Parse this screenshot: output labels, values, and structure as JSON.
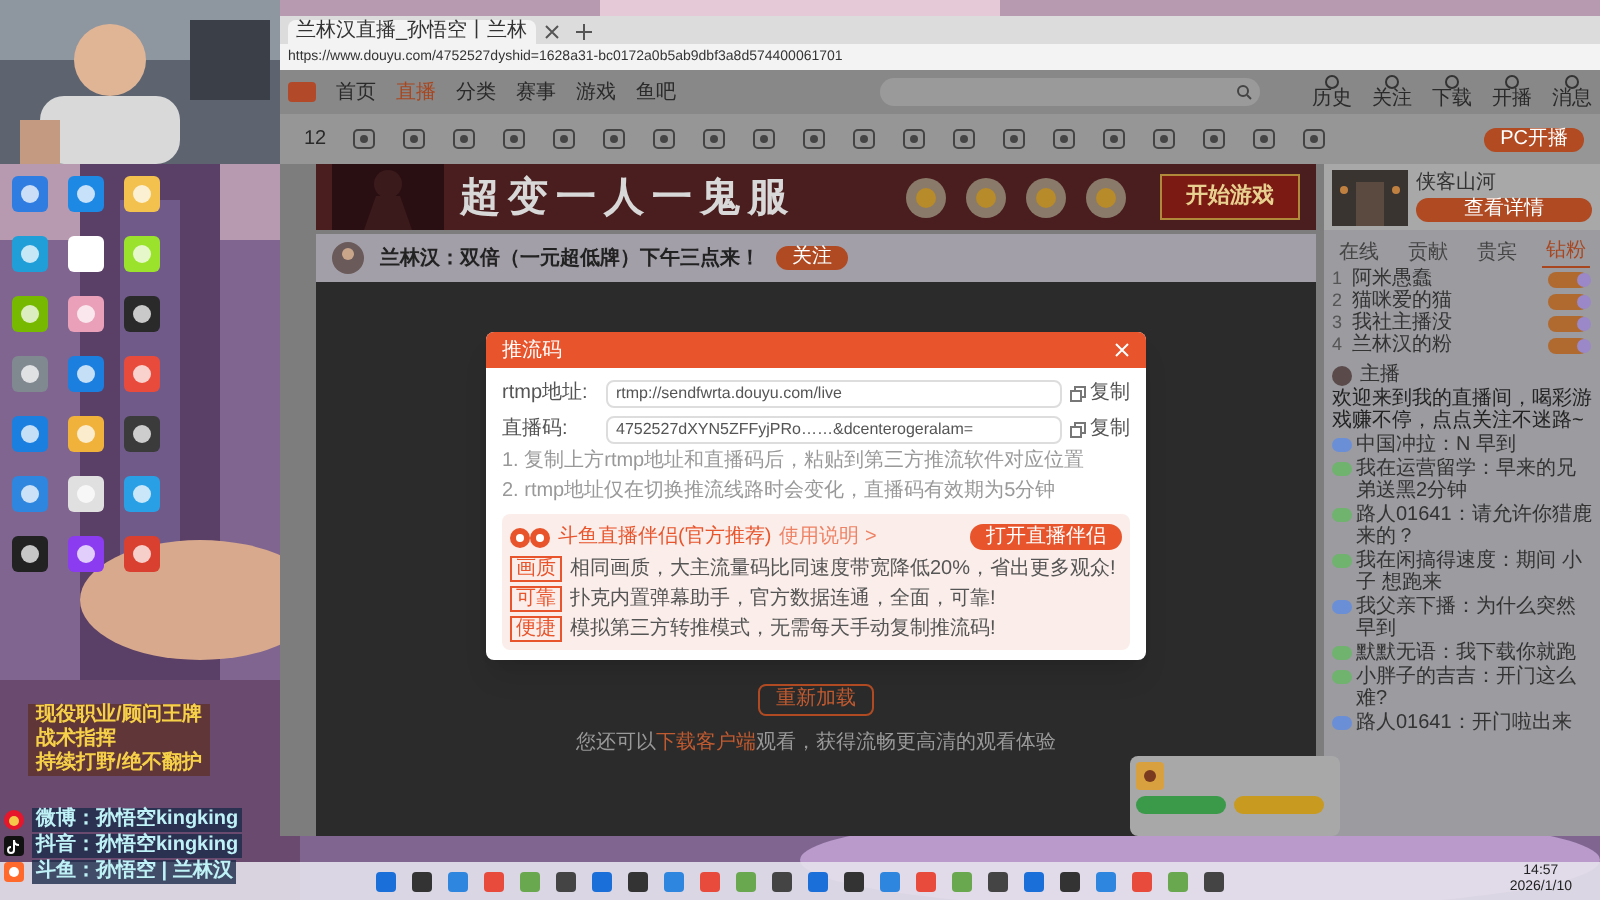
{
  "stream_overlay": {
    "promo_lines": [
      "现役职业/顾问王牌",
      "战术指挥",
      "持续打野/绝不翻护"
    ],
    "socials": [
      {
        "kind": "weibo",
        "text": "微博：孙悟空kingking"
      },
      {
        "kind": "douyin",
        "text": "抖音：孙悟空kingking"
      },
      {
        "kind": "douyu",
        "text": "斗鱼：孙悟空 | 兰林汉"
      }
    ]
  },
  "browser": {
    "tab_title": "兰林汉直播_孙悟空丨兰林",
    "url": "https://www.douyu.com/4752527dyshid=1628a31-bc0172a0b5ab9dbf3a8d574400061701"
  },
  "site_nav": {
    "links": [
      {
        "label": "首页",
        "selected": false
      },
      {
        "label": "直播",
        "selected": true
      },
      {
        "label": "分类",
        "selected": false
      },
      {
        "label": "赛事",
        "selected": false
      },
      {
        "label": "游戏",
        "selected": false
      },
      {
        "label": "鱼吧",
        "selected": false
      }
    ],
    "actions": [
      "历史",
      "关注",
      "下载",
      "开播",
      "消息"
    ]
  },
  "tools": {
    "score": "12",
    "button": "PC开播"
  },
  "banner": {
    "title": "超变一人一鬼服",
    "button": "开始游戏"
  },
  "room": {
    "title": "兰林汉：双倍（一元超低牌）下午三点来！",
    "follow": "关注"
  },
  "modal": {
    "title": "推流码",
    "fields": [
      {
        "label": "rtmp地址:",
        "value": "rtmp://sendfwrta.douyu.com/live",
        "copy": "复制"
      },
      {
        "label": "直播码:",
        "value": "4752527dXYN5ZFFyjPRo……&dcenterogeralam=",
        "copy": "复制"
      }
    ],
    "notes": [
      "1. 复制上方rtmp地址和直播码后，粘贴到第三方推流软件对应位置",
      "2. rtmp地址仅在切换推流线路时会变化，直播码有效期为5分钟"
    ],
    "promo": {
      "title": "斗鱼直播伴侣(官方推荐)",
      "link": "使用说明 >",
      "button": "打开直播伴侣",
      "rows": [
        {
          "tag": "画质",
          "text": "相同画质，大主流量码比同速度带宽降低20%，省出更多观众!"
        },
        {
          "tag": "可靠",
          "text": "扑克内置弹幕助手，官方数据连通，全面，可靠!"
        },
        {
          "tag": "便捷",
          "text": "模拟第三方转推模式，无需每天手动复制推流码!"
        }
      ]
    }
  },
  "player": {
    "reload": "重新加载",
    "hint_before": "您还可以",
    "hint_link": "下载客户端",
    "hint_after": "观看，获得流畅更高清的观看体验"
  },
  "side": {
    "game": {
      "name": "侠客山河",
      "button": "查看详情"
    },
    "tabs": [
      {
        "label": "在线",
        "selected": false
      },
      {
        "label": "贡献",
        "selected": false
      },
      {
        "label": "贵宾",
        "selected": false
      },
      {
        "label": "钻粉",
        "selected": true
      }
    ],
    "ranks": [
      {
        "n": "1",
        "name": "阿米愚蠢"
      },
      {
        "n": "2",
        "name": "猫咪爱的猫"
      },
      {
        "n": "3",
        "name": "我社主播没"
      },
      {
        "n": "4",
        "name": "兰林汉的粉"
      }
    ],
    "host": {
      "name": "主播",
      "text": "欢迎来到我的直播间，喝彩游戏赚不停，点点关注不迷路~"
    },
    "chat": [
      {
        "user": "中国冲拉：",
        "text": "N 早到",
        "color": "#6b8fd6"
      },
      {
        "user": "我在运营留学：",
        "text": "早来的兄弟送黑2分钟",
        "color": "#6fb36f"
      },
      {
        "user": "路人01641：",
        "text": "请允许你猎鹿来的？",
        "color": "#6fb36f"
      },
      {
        "user": "我在闲搞得速度：",
        "text": "期间 小子 想跑来",
        "color": "#6fb36f"
      },
      {
        "user": "我父亲下播：",
        "text": "为什么突然早到",
        "color": "#6b8fd6"
      },
      {
        "user": "默默无语：",
        "text": "我下载你就跑",
        "color": "#6fb36f"
      },
      {
        "user": "小胖子的吉吉：",
        "text": "开门这么难?",
        "color": "#6fb36f"
      },
      {
        "user": "路人01641：",
        "text": "开门啦出来",
        "color": "#6b8fd6"
      }
    ]
  },
  "taskbar": {
    "time": "14:57",
    "date": "2026/1/10"
  }
}
